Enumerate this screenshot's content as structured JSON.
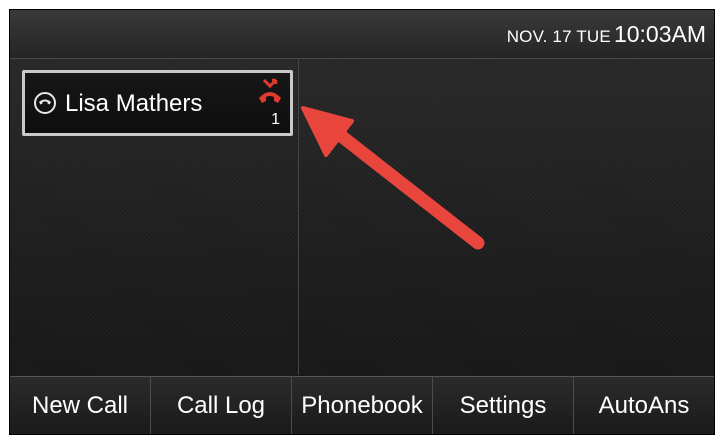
{
  "status_bar": {
    "date": "NOV. 17 TUE",
    "time": "10:03AM"
  },
  "line_panel": {
    "active_call": {
      "name": "Lisa Mathers",
      "missed_count": "1",
      "line_icon": "phone-handset-icon",
      "status_icon": "missed-call-icon"
    }
  },
  "softkeys": [
    {
      "label": "New Call"
    },
    {
      "label": "Call Log"
    },
    {
      "label": "Phonebook"
    },
    {
      "label": "Settings"
    },
    {
      "label": "AutoAns"
    }
  ],
  "colors": {
    "annotation_arrow": "#e8453c",
    "missed_call_icon": "#e03a2f",
    "card_border": "#c9c9c9",
    "background": "#1e1e1e"
  }
}
